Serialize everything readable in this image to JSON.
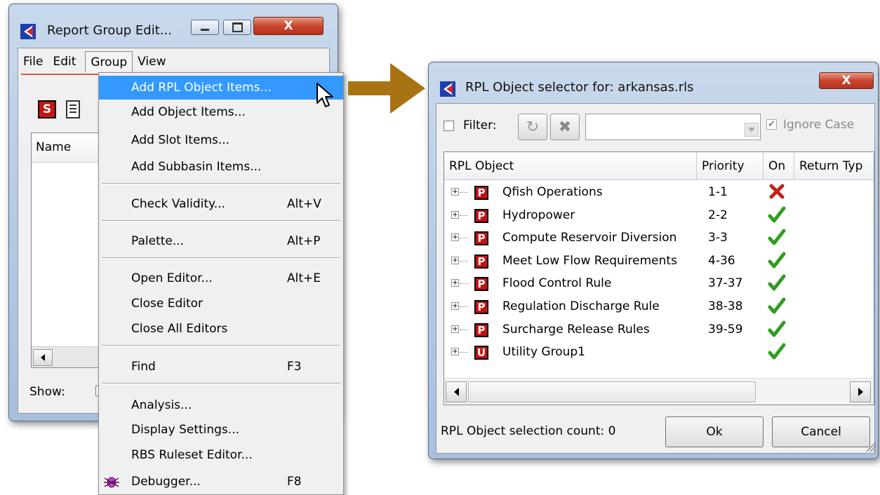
{
  "report_window": {
    "title": "Report Group Edit...",
    "menu": [
      "File",
      "Edit",
      "Group",
      "View"
    ],
    "column_header": "Name",
    "show_label": "Show:"
  },
  "group_menu": {
    "items": [
      {
        "label": "Add RPL Object Items...",
        "shortcut": "",
        "highlighted": true
      },
      {
        "label": "Add Object Items...",
        "shortcut": ""
      },
      {
        "label": "Add Slot Items...",
        "shortcut": ""
      },
      {
        "label": "Add Subbasin Items...",
        "shortcut": ""
      },
      {
        "label": "Check Validity...",
        "shortcut": "Alt+V"
      },
      {
        "label": "Palette...",
        "shortcut": "Alt+P"
      },
      {
        "label": "Open Editor...",
        "shortcut": "Alt+E"
      },
      {
        "label": "Close Editor",
        "shortcut": ""
      },
      {
        "label": "Close All Editors",
        "shortcut": ""
      },
      {
        "label": "Find",
        "shortcut": "F3"
      },
      {
        "label": "Analysis...",
        "shortcut": ""
      },
      {
        "label": "Display Settings...",
        "shortcut": ""
      },
      {
        "label": "RBS Ruleset Editor...",
        "shortcut": ""
      },
      {
        "label": "Debugger...",
        "shortcut": "F8",
        "icon": "bug-icon"
      }
    ]
  },
  "selector_window": {
    "title": "RPL Object selector for: arkansas.rls",
    "filter_label": "Filter:",
    "filter_checked": false,
    "ignore_case_label": "Ignore Case",
    "ignore_case_checked": true,
    "columns": [
      "RPL Object",
      "Priority",
      "On",
      "Return Typ"
    ],
    "rows": [
      {
        "badge": "P",
        "name": "Qfish Operations",
        "priority": "1-1",
        "on": "off"
      },
      {
        "badge": "P",
        "name": "Hydropower",
        "priority": "2-2",
        "on": "on"
      },
      {
        "badge": "P",
        "name": "Compute Reservoir Diversion",
        "priority": "3-3",
        "on": "on"
      },
      {
        "badge": "P",
        "name": "Meet Low Flow Requirements",
        "priority": "4-36",
        "on": "on"
      },
      {
        "badge": "P",
        "name": "Flood Control Rule",
        "priority": "37-37",
        "on": "on"
      },
      {
        "badge": "P",
        "name": "Regulation Discharge Rule",
        "priority": "38-38",
        "on": "on"
      },
      {
        "badge": "P",
        "name": "Surcharge Release Rules",
        "priority": "39-59",
        "on": "on"
      },
      {
        "badge": "U",
        "name": "Utility Group1",
        "priority": "",
        "on": "on"
      }
    ],
    "status": "RPL Object selection count: 0",
    "ok_label": "Ok",
    "cancel_label": "Cancel"
  },
  "icons": {
    "app": "riverware-icon",
    "refresh": "refresh-icon",
    "clear": "clear-filter-icon",
    "cursor": "mouse-pointer-icon",
    "arrow": "arrow-right-icon",
    "on": "green-check-icon",
    "off": "red-x-icon"
  },
  "colors": {
    "highlight": "#3399ff",
    "badge_red": "#c80f0f",
    "arrow": "#a87413",
    "check_green": "#2f9e1f",
    "x_red": "#c0221a"
  }
}
